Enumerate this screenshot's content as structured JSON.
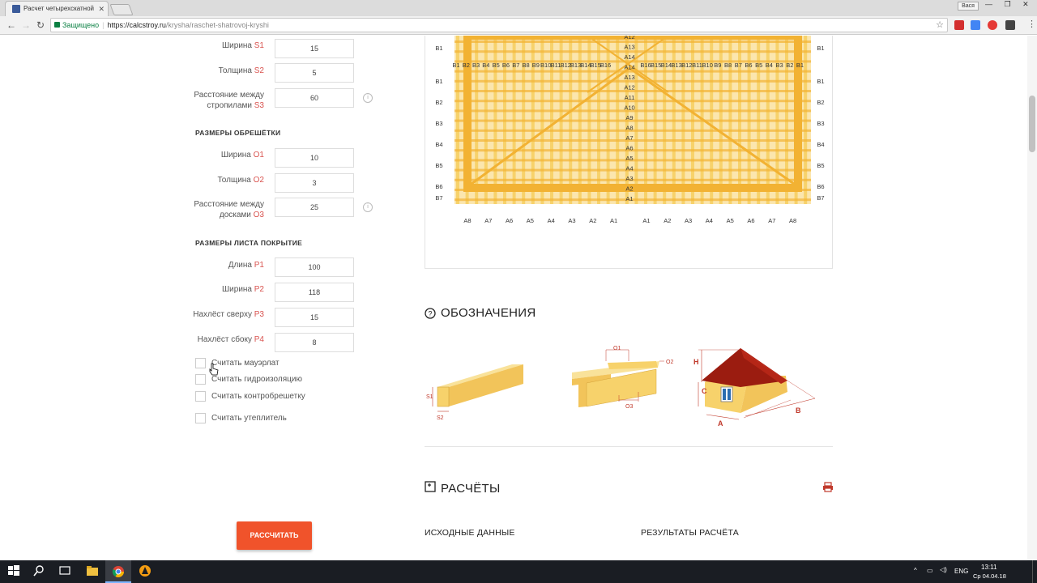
{
  "browser": {
    "tab_title": "Расчет четырехскатной",
    "tab_close": "✕",
    "user_chip": "Вася",
    "window_controls": "— ❐ ✕",
    "security_label": "Защищено",
    "url_host": "https://calcstroy.ru",
    "url_path": "/krysha/raschet-shatrovoj-kryshi",
    "ext_icons": [
      "pdf-ext-icon",
      "translate-ext-icon",
      "abp-ext-icon",
      "chat-ext-icon"
    ]
  },
  "form": {
    "fields_top": [
      {
        "label": "Ширина",
        "code": "S1",
        "value": "15"
      },
      {
        "label": "Толщина",
        "code": "S2",
        "value": "5"
      },
      {
        "label_line1": "Расстояние между",
        "label_line2": "стропилами",
        "code": "S3",
        "value": "60"
      }
    ],
    "section_lathing": "РАЗМЕРЫ ОБРЕШЁТКИ",
    "fields_lathing": [
      {
        "label": "Ширина",
        "code": "O1",
        "value": "10"
      },
      {
        "label": "Толщина",
        "code": "O2",
        "value": "3"
      },
      {
        "label_line1": "Расстояние между",
        "label_line2": "досками",
        "code": "O3",
        "value": "25"
      }
    ],
    "section_sheet": "РАЗМЕРЫ ЛИСТА ПОКРЫТИЕ",
    "fields_sheet": [
      {
        "label": "Длина",
        "code": "P1",
        "value": "100"
      },
      {
        "label": "Ширина",
        "code": "P2",
        "value": "118"
      },
      {
        "label": "Нахлёст сверху",
        "code": "P3",
        "value": "15"
      },
      {
        "label": "Нахлёст сбоку",
        "code": "P4",
        "value": "8"
      }
    ],
    "checkboxes": [
      {
        "label": "Считать мауэрлат",
        "checked": false
      },
      {
        "label": "Считать гидроизоляцию",
        "checked": false
      },
      {
        "label": "Считать контробрешетку",
        "checked": false
      },
      {
        "label": "Считать утеплитель",
        "checked": false
      }
    ],
    "info_glyph": "i",
    "calc_button": "РАССЧИТАТЬ"
  },
  "scheme": {
    "top_b_left": [
      "B1",
      "B2",
      "B3",
      "B4",
      "B5",
      "B6",
      "B7",
      "B8",
      "B9",
      "B10",
      "B11",
      "B12",
      "B13",
      "B14",
      "B15",
      "B16"
    ],
    "top_b_right": [
      "B16",
      "B15",
      "B14",
      "B13",
      "B12",
      "B11",
      "B10",
      "B9",
      "B8",
      "B7",
      "B6",
      "B5",
      "B4",
      "B3",
      "B2",
      "B1"
    ],
    "center_a": [
      "A12",
      "A13",
      "A14",
      "A14",
      "A13",
      "A12",
      "A11",
      "A10",
      "A9",
      "A8",
      "A7",
      "A6",
      "A5",
      "A4",
      "A3",
      "A2",
      "A1"
    ],
    "side_b": [
      "B1",
      "B1",
      "B2",
      "B3",
      "B4",
      "B5",
      "B6",
      "B7"
    ],
    "bottom_a_left": [
      "A8",
      "A7",
      "A6",
      "A5",
      "A4",
      "A3",
      "A2",
      "A1"
    ],
    "bottom_a_right": [
      "A1",
      "A2",
      "A3",
      "A4",
      "A5",
      "A6",
      "A7",
      "A8"
    ]
  },
  "legend": {
    "title": "ОБОЗНАЧЕНИЯ",
    "beam_labels": {
      "s1": "S1",
      "s2": "S2"
    },
    "board_labels": {
      "o1": "O1",
      "o2": "O2",
      "o3": "O3"
    },
    "house_labels": {
      "h": "H",
      "c": "C",
      "a": "A",
      "b": "B"
    }
  },
  "results": {
    "title": "РАСЧЁТЫ",
    "input_data": "ИСХОДНЫЕ ДАННЫЕ",
    "calc_results": "РЕЗУЛЬТАТЫ РАСЧЁТА"
  },
  "taskbar": {
    "lang": "ENG",
    "time": "13:11",
    "date": "Ср 04.04.18"
  },
  "colors": {
    "accent": "#f0532b",
    "code_red": "#d9534f",
    "wood": "#f7d26b",
    "wood_dark": "#f2b233"
  }
}
